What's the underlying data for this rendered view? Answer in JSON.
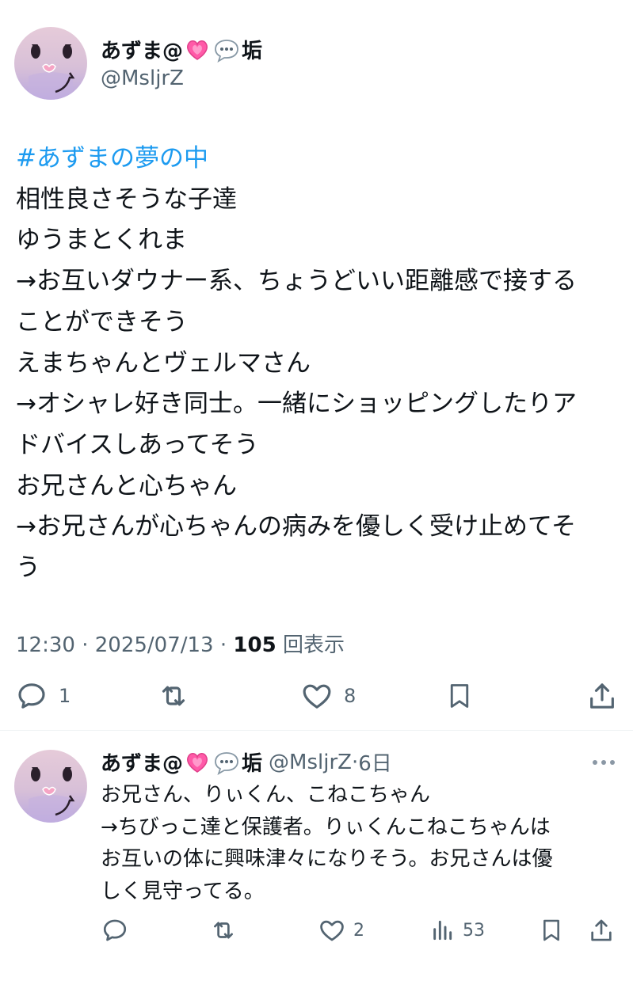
{
  "tweet": {
    "author_name": "あずま@",
    "author_suffix": "垢",
    "handle": "@MsljrZ",
    "lines": [
      "#あずまの夢の中",
      "相性良さそうな子達",
      "ゆうまとくれま",
      "→お互いダウナー系、ちょうどいい距離感で接する",
      "ことができそう",
      "えまちゃんとヴェルマさん",
      "→オシャレ好き同士。一緒にショッピングしたりア",
      "ドバイスしあってそう",
      "お兄さんと心ちゃん",
      "→お兄さんが心ちゃんの病みを優しく受け止めてそ",
      "う"
    ],
    "time": "12:30",
    "date": "2025/07/13",
    "views": "105",
    "views_label": "回表示",
    "replies": "1",
    "likes": "8"
  },
  "reply": {
    "author_name": "あずま@",
    "author_suffix": "垢",
    "handle": "@MsljrZ",
    "age": "6日",
    "lines": [
      "お兄さん、りぃくん、こねこちゃん",
      "→ちびっこ達と保護者。りぃくんこねこちゃんは",
      "お互いの体に興味津々になりそう。お兄さんは優",
      "しく見守ってる。"
    ],
    "likes": "2",
    "views": "53"
  },
  "icons": [
    "heart-emoji",
    "speech-bubble-emoji",
    "reply-icon",
    "retweet-icon",
    "like-icon",
    "bookmark-icon",
    "share-icon",
    "views-icon",
    "more-icon"
  ],
  "colors": {
    "hashtag": "#1d9bf0",
    "secondary": "#536471",
    "text": "#0f1419",
    "heart_emoji": "#ff5aa8"
  }
}
